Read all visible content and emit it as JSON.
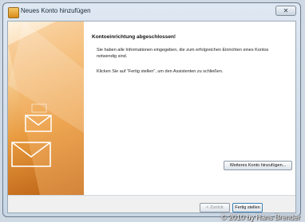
{
  "window": {
    "title": "Neues Konto hinzufügen",
    "close_glyph": "✕"
  },
  "content": {
    "heading": "Kontoeinrichtung abgeschlossen!",
    "paragraph1": "Sie haben alle Informationen eingegeben, die zum erfolgreichen Einrichten eines Kontos notwendig sind.",
    "paragraph2": "Klicken Sie auf \"Fertig stellen\", um den Assistenten zu schließen.",
    "add_account_button": "Weiteres Konto hinzufügen..."
  },
  "footer": {
    "back_button": "< Zurück",
    "finish_button": "Fertig stellen"
  },
  "watermark": "© 2010 by Hans Brender",
  "colors": {
    "accent": "#e89a3e",
    "button_border": "#3c7fb1"
  }
}
